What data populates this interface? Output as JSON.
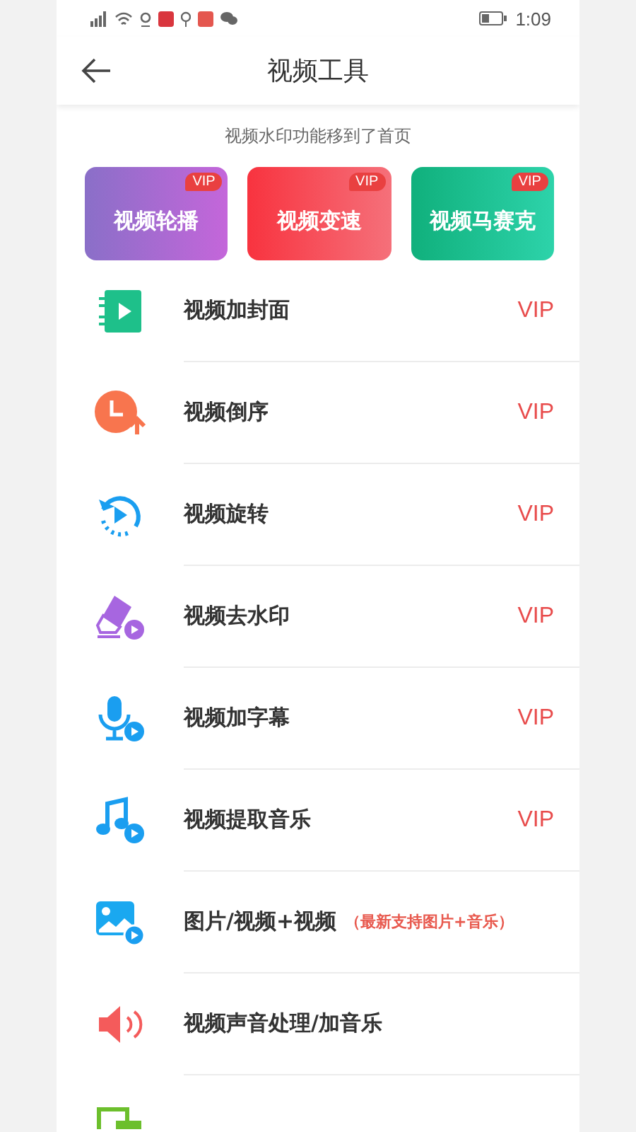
{
  "status_bar": {
    "time": "1:09"
  },
  "header": {
    "title": "视频工具"
  },
  "notice": "视频水印功能移到了首页",
  "cards": [
    {
      "label": "视频轮播",
      "badge": "VIP",
      "kind": "purple"
    },
    {
      "label": "视频变速",
      "badge": "VIP",
      "kind": "red"
    },
    {
      "label": "视频马赛克",
      "badge": "VIP",
      "kind": "green"
    }
  ],
  "tools": [
    {
      "kind": "cover",
      "title": "视频加封面",
      "tag": "VIP"
    },
    {
      "kind": "reverse",
      "title": "视频倒序",
      "tag": "VIP"
    },
    {
      "kind": "rotate",
      "title": "视频旋转",
      "tag": "VIP"
    },
    {
      "kind": "eraser",
      "title": "视频去水印",
      "tag": "VIP"
    },
    {
      "kind": "mic",
      "title": "视频加字幕",
      "tag": "VIP"
    },
    {
      "kind": "music",
      "title": "视频提取音乐",
      "tag": "VIP"
    },
    {
      "kind": "image",
      "title": "图片/视频+视频",
      "note": "（最新支持图片+音乐）"
    },
    {
      "kind": "speaker",
      "title": "视频声音处理/加音乐"
    },
    {
      "kind": "transition"
    }
  ]
}
